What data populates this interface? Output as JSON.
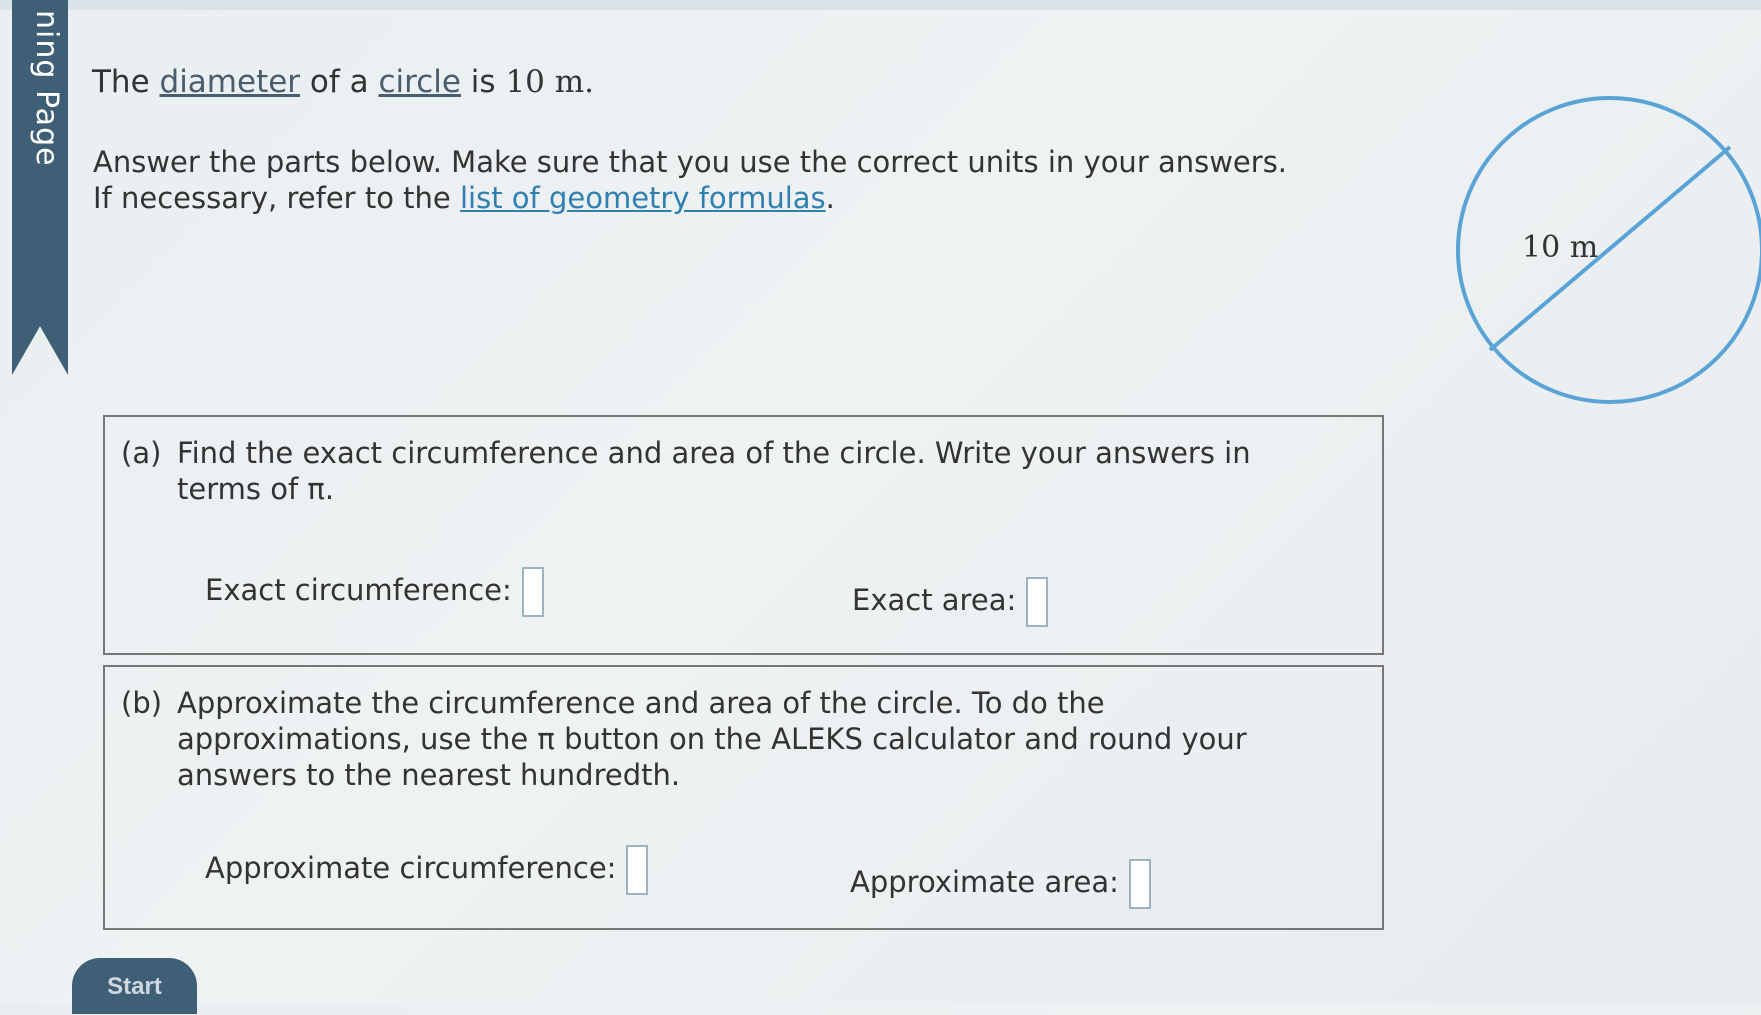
{
  "sidebar": {
    "tab_label": "ning Page"
  },
  "problem": {
    "intro_prefix": "The ",
    "diameter_word": "diameter",
    "intro_middle": " of a ",
    "circle_word": "circle",
    "intro_is": " is ",
    "measure": "10 m.",
    "instruction_line1": "Answer the parts below. Make sure that you use the correct units in your answers.",
    "instruction_line2_prefix": "If necessary, refer to the ",
    "formulas_link": "list of geometry formulas",
    "instruction_line2_suffix": "."
  },
  "diagram": {
    "label": "10 m",
    "stroke_color": "#5aa3d6"
  },
  "part_a": {
    "letter": "(a)",
    "text": "Find the exact circumference and area of the circle. Write your answers in terms of π.",
    "circumference_label": "Exact circumference:",
    "area_label": "Exact area:"
  },
  "part_b": {
    "letter": "(b)",
    "text": "Approximate the circumference and area of the circle. To do the approximations, use the π button on the ALEKS calculator and round your answers to the nearest hundredth.",
    "circumference_label": "Approximate circumference:",
    "area_label": "Approximate area:"
  },
  "footer": {
    "start_label": "Start"
  }
}
